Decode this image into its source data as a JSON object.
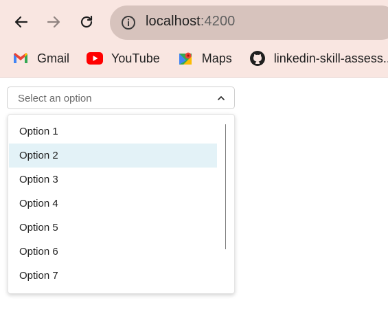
{
  "browser": {
    "back_icon": "arrow-left-icon",
    "forward_icon": "arrow-right-icon",
    "reload_icon": "reload-icon",
    "info_icon": "info-icon",
    "url_host": "localhost",
    "url_port": ":4200",
    "bookmarks": [
      {
        "label": "Gmail",
        "icon": "gmail-icon"
      },
      {
        "label": "YouTube",
        "icon": "youtube-icon"
      },
      {
        "label": "Maps",
        "icon": "maps-icon"
      },
      {
        "label": "linkedin-skill-assess...",
        "icon": "github-icon"
      }
    ]
  },
  "select": {
    "placeholder": "Select an option",
    "open": true,
    "options": [
      "Option 1",
      "Option 2",
      "Option 3",
      "Option 4",
      "Option 5",
      "Option 6",
      "Option 7"
    ],
    "highlighted": "Option 2"
  },
  "colors": {
    "chrome_bg": "#f9e6e1",
    "omnibox_bg": "#d7c3bd",
    "highlight_bg": "#e3f2f7"
  }
}
